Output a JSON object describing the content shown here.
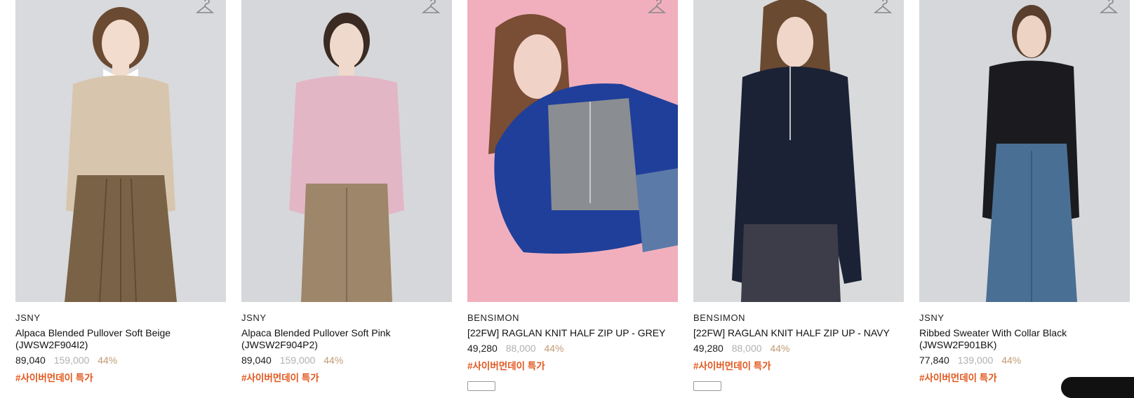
{
  "products": [
    {
      "brand": "JSNY",
      "name": "Alpaca Blended Pullover Soft Beige (JWSW2F904I2)",
      "sale_price": "89,040",
      "original_price": "159,000",
      "discount": "44%",
      "tag": "#사이버먼데이 특가",
      "photo_colors": {
        "bg": "#d8dadd",
        "top": "#d8c5ad",
        "bottom": "#7a6246"
      },
      "icon": "hanger-icon"
    },
    {
      "brand": "JSNY",
      "name": "Alpaca Blended Pullover Soft Pink (JWSW2F904P2)",
      "sale_price": "89,040",
      "original_price": "159,000",
      "discount": "44%",
      "tag": "#사이버먼데이 특가",
      "photo_colors": {
        "bg": "#d6d7da",
        "top": "#e3b6c6",
        "bottom": "#9d8669"
      },
      "icon": "hanger-icon"
    },
    {
      "brand": "BENSIMON",
      "name": "[22FW] RAGLAN KNIT HALF ZIP UP - GREY",
      "sale_price": "49,280",
      "original_price": "88,000",
      "discount": "44%",
      "tag": "#사이버먼데이 특가",
      "photo_colors": {
        "bg": "#f1afbd",
        "top": "#8a8d91",
        "bottom": "#1f3f9a"
      },
      "icon": "hanger-icon"
    },
    {
      "brand": "BENSIMON",
      "name": "[22FW] RAGLAN KNIT HALF ZIP UP - NAVY",
      "sale_price": "49,280",
      "original_price": "88,000",
      "discount": "44%",
      "tag": "#사이버먼데이 특가",
      "photo_colors": {
        "bg": "#d9dadc",
        "top": "#1b2236",
        "bottom": "#3c3d48"
      },
      "icon": "hanger-icon"
    },
    {
      "brand": "JSNY",
      "name": "Ribbed Sweater With Collar Black (JWSW2F901BK)",
      "sale_price": "77,840",
      "original_price": "139,000",
      "discount": "44%",
      "tag": "#사이버먼데이 특가",
      "photo_colors": {
        "bg": "#d5d7db",
        "top": "#1a1a1f",
        "bottom": "#4a6f94"
      },
      "icon": "hanger-icon"
    }
  ],
  "colors": {
    "tag": "#e2571d",
    "discount": "#c29b73",
    "original_price": "#b0b0b0"
  }
}
